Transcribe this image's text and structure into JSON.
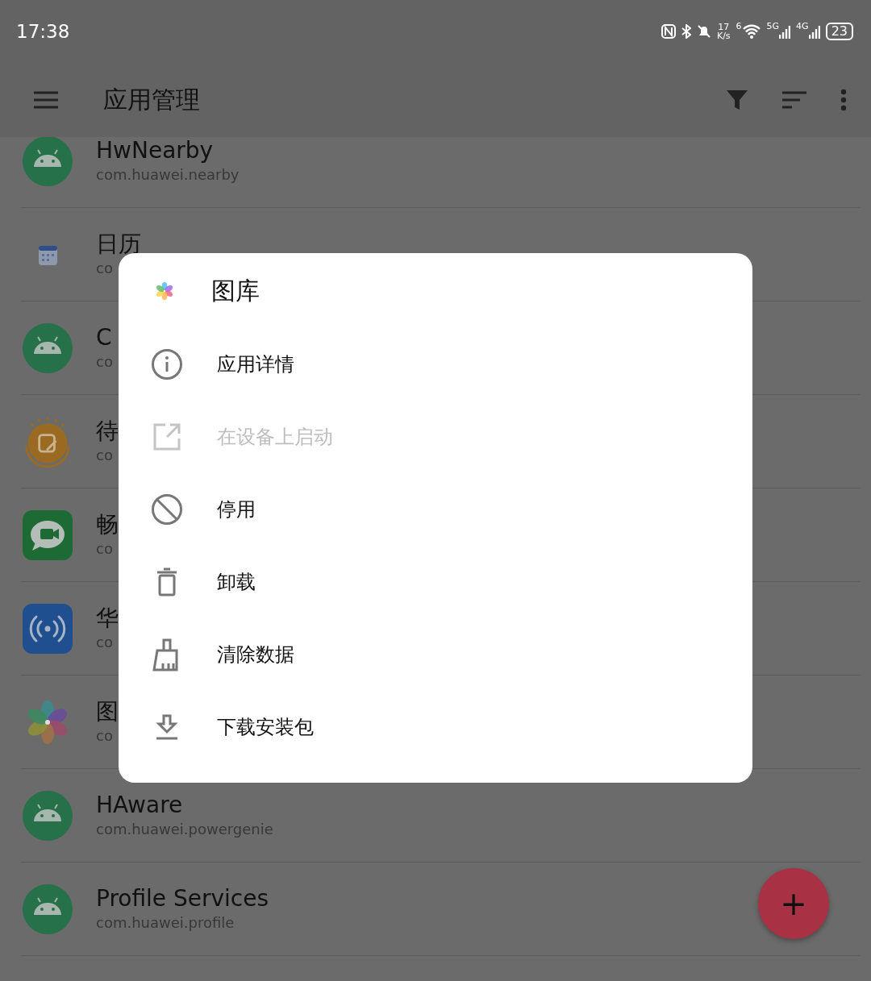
{
  "status_bar": {
    "time": "17:38",
    "speed_value": "17",
    "speed_unit": "K/s",
    "wifi_band": "6",
    "sim1_type": "5G",
    "sim2_type": "4G",
    "battery": "23"
  },
  "app_bar": {
    "title": "应用管理"
  },
  "apps": [
    {
      "name": "HwNearby",
      "package": "com.huawei.nearby",
      "kind": "android"
    },
    {
      "name": "日历",
      "package": "co",
      "kind": "calendar"
    },
    {
      "name": "C",
      "package": "co",
      "kind": "android"
    },
    {
      "name": "待",
      "package": "co",
      "kind": "notes"
    },
    {
      "name": "畅",
      "package": "co",
      "kind": "chat"
    },
    {
      "name": "华",
      "package": "co",
      "kind": "broadcast"
    },
    {
      "name": "图",
      "package": "co",
      "kind": "gallery"
    },
    {
      "name": "HAware",
      "package": "com.huawei.powergenie",
      "kind": "android"
    },
    {
      "name": "Profile Services",
      "package": "com.huawei.profile",
      "kind": "android"
    }
  ],
  "fab": {
    "label": "+"
  },
  "dialog": {
    "title": "图库",
    "actions": [
      {
        "label": "应用详情",
        "kind": "info",
        "disabled": false
      },
      {
        "label": "在设备上启动",
        "kind": "open",
        "disabled": true
      },
      {
        "label": "停用",
        "kind": "block",
        "disabled": false
      },
      {
        "label": "卸载",
        "kind": "delete",
        "disabled": false
      },
      {
        "label": "清除数据",
        "kind": "broom",
        "disabled": false
      },
      {
        "label": "下载安装包",
        "kind": "download",
        "disabled": false
      }
    ]
  }
}
